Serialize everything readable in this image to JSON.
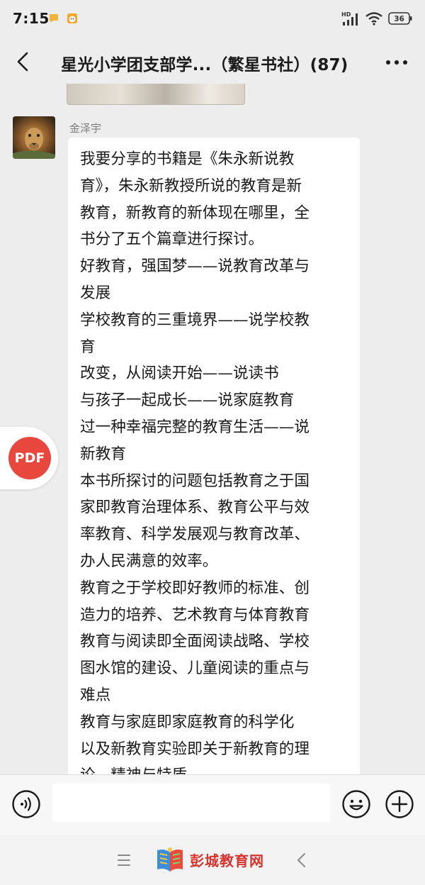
{
  "status_bar": {
    "time": "7:15",
    "network": "HD",
    "battery": "36"
  },
  "header": {
    "title": "星光小学团支部学...（繁星书社）(87)"
  },
  "message": {
    "sender": "金泽宇",
    "lines": [
      "我要分享的书籍是《朱永新说教",
      "育》，朱永新教授所说的教育是新",
      "教育，新教育的新体现在哪里，全",
      "书分了五个篇章进行探讨。",
      "好教育，强国梦——说教育改革与",
      "发展",
      "学校教育的三重境界——说学校教",
      "育",
      "改变，从阅读开始——说读书",
      "与孩子一起成长——说家庭教育",
      "过一种幸福完整的教育生活——说",
      "新教育",
      "本书所探讨的问题包括教育之于国",
      "家即教育治理体系、教育公平与效",
      "率教育、科学发展观与教育改革、",
      "办人民满意的效率。",
      "教育之于学校即好教师的标准、创",
      "造力的培养、艺术教育与体育教育",
      "教育与阅读即全面阅读战略、学校",
      "图水馆的建设、儿童阅读的重点与",
      "难点",
      "教育与家庭即家庭教育的科学化",
      "以及新教育实验即关于新教育的理",
      "论、精神与特质。"
    ]
  },
  "pdf_button": {
    "label": "PDF"
  },
  "input_bar": {
    "value": ""
  },
  "watermark": {
    "text": "彭城教育网"
  },
  "colors": {
    "background": "#ededed",
    "bubble": "#ffffff",
    "pdf_red": "#e8473e",
    "watermark_red": "#d8332c"
  },
  "icons": {
    "back": "chevron-left-icon",
    "more": "more-dots-icon",
    "voice": "voice-icon",
    "emoji": "emoji-icon",
    "plus": "plus-icon",
    "nav_menu": "menu-icon",
    "nav_back": "nav-back-icon"
  }
}
